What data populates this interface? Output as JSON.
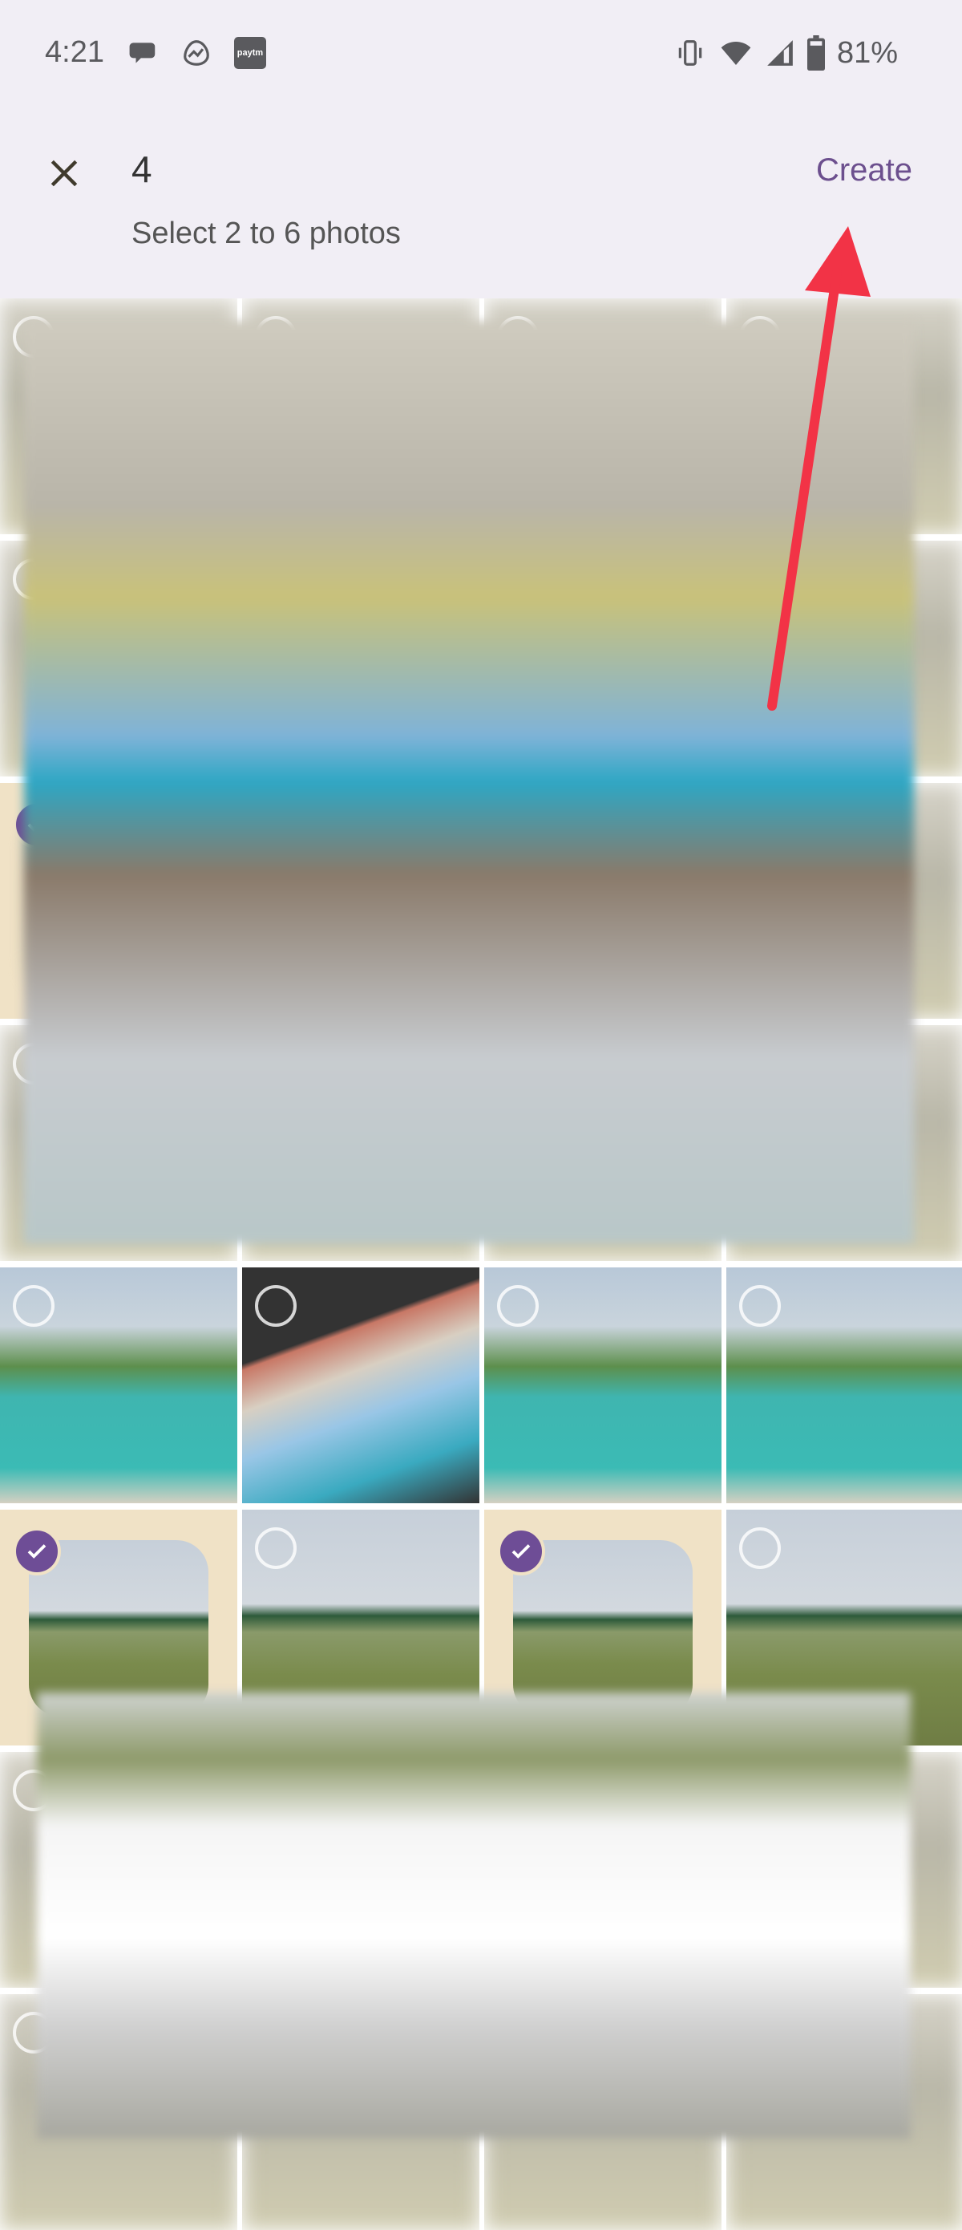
{
  "status_bar": {
    "time": "4:21",
    "left_icons": [
      "messages-icon",
      "basecamp-icon",
      "paytm-icon"
    ],
    "paytm_label": "paytm",
    "right_icons": [
      "vibrate-icon",
      "wifi-icon",
      "signal-icon",
      "battery-icon"
    ],
    "battery": "81%"
  },
  "appbar": {
    "selected_count": "4",
    "subtitle": "Select 2 to 6 photos",
    "create_label": "Create",
    "accent_color": "#6c4f8e"
  },
  "grid": {
    "rows": [
      {
        "tiles": [
          {
            "kind": "blurred"
          },
          {
            "kind": "blurred"
          },
          {
            "kind": "blurred"
          },
          {
            "kind": "blurred"
          }
        ]
      },
      {
        "tiles": [
          {
            "kind": "blurred"
          },
          {
            "kind": "blurred"
          },
          {
            "kind": "blurred"
          },
          {
            "kind": "blurred"
          }
        ]
      },
      {
        "tiles": [
          {
            "kind": "blurred",
            "selected": true
          },
          {
            "kind": "blurred"
          },
          {
            "kind": "blurred"
          },
          {
            "kind": "blurred"
          }
        ]
      },
      {
        "tiles": [
          {
            "kind": "blurred"
          },
          {
            "kind": "blurred"
          },
          {
            "kind": "blurred"
          },
          {
            "kind": "blurred"
          }
        ]
      },
      {
        "tiles": [
          {
            "kind": "pool",
            "selected": false
          },
          {
            "kind": "collage",
            "selected": false
          },
          {
            "kind": "pool",
            "selected": false
          },
          {
            "kind": "pool",
            "selected": false
          }
        ]
      },
      {
        "tiles": [
          {
            "kind": "lawn",
            "selected": true
          },
          {
            "kind": "lawn",
            "selected": false
          },
          {
            "kind": "lawn",
            "selected": true
          },
          {
            "kind": "lawn",
            "selected": false
          }
        ]
      },
      {
        "tiles": [
          {
            "kind": "blurred"
          },
          {
            "kind": "blurred"
          },
          {
            "kind": "blurred"
          },
          {
            "kind": "blurred"
          }
        ]
      },
      {
        "tiles": [
          {
            "kind": "blurred"
          },
          {
            "kind": "blurred"
          },
          {
            "kind": "blurred"
          },
          {
            "kind": "blurred"
          }
        ]
      }
    ]
  },
  "annotation": {
    "arrow_color": "#f23346",
    "points_to": "Create"
  }
}
